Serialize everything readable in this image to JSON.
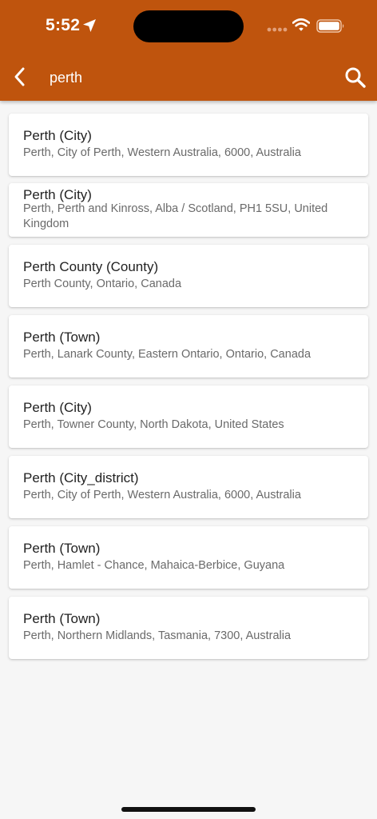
{
  "status_bar": {
    "time": "5:52"
  },
  "app_bar": {
    "search_query": "perth",
    "back_icon": "chevron-left-icon",
    "search_icon": "search-icon"
  },
  "results": [
    {
      "title": "Perth (City)",
      "subtitle": "Perth, City of Perth, Western Australia, 6000, Australia"
    },
    {
      "title": "Perth (City)",
      "subtitle": "Perth, Perth and Kinross, Alba / Scotland, PH1 5SU, United Kingdom"
    },
    {
      "title": "Perth County (County)",
      "subtitle": "Perth County, Ontario, Canada"
    },
    {
      "title": "Perth (Town)",
      "subtitle": "Perth, Lanark County, Eastern Ontario, Ontario, Canada"
    },
    {
      "title": "Perth (City)",
      "subtitle": "Perth, Towner County, North Dakota, United States"
    },
    {
      "title": "Perth (City_district)",
      "subtitle": "Perth, City of Perth, Western Australia, 6000, Australia"
    },
    {
      "title": "Perth (Town)",
      "subtitle": "Perth, Hamlet - Chance, Mahaica-Berbice, Guyana"
    },
    {
      "title": "Perth (Town)",
      "subtitle": "Perth, Northern Midlands, Tasmania, 7300, Australia"
    }
  ],
  "colors": {
    "app_bar": "#bf540d",
    "background": "#f6f6f6",
    "card": "#ffffff",
    "title_text": "#222222",
    "subtitle_text": "#6a6a6a"
  }
}
